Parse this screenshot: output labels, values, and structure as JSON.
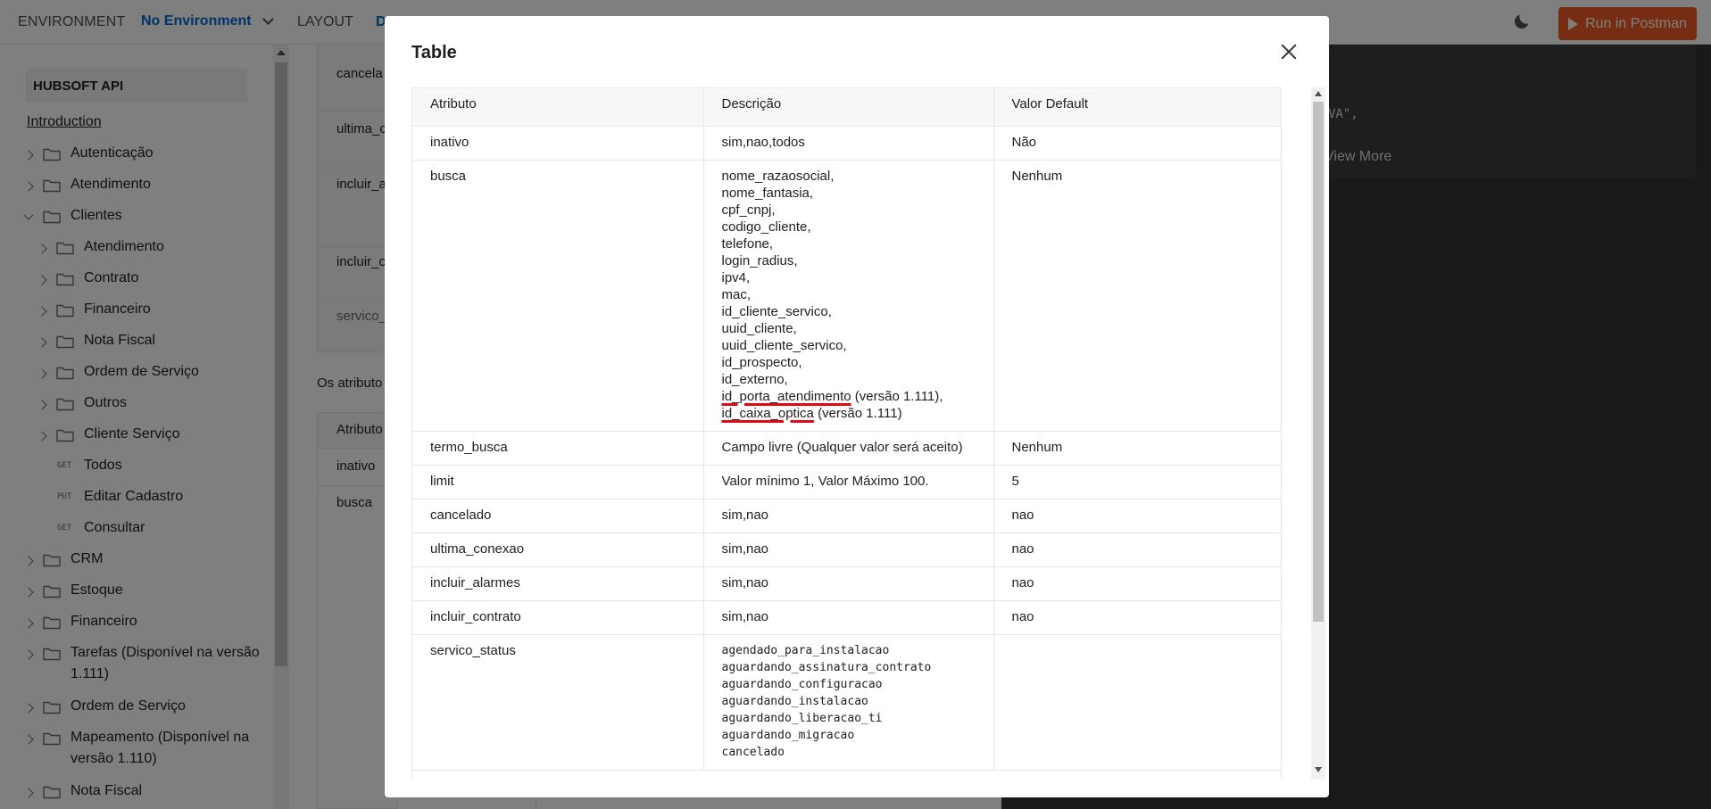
{
  "topbar": {
    "environment_label": "ENVIRONMENT",
    "environment_value": "No Environment",
    "layout_label": "LAYOUT",
    "partial_label": "D",
    "run_button": "Run in Postman"
  },
  "sidebar": {
    "title": "HUBSOFT API",
    "introduction": "Introduction",
    "items": [
      {
        "label": "Autenticação",
        "type": "folder"
      },
      {
        "label": "Atendimento",
        "type": "folder"
      },
      {
        "label": "Clientes",
        "type": "folder",
        "expanded": true
      },
      {
        "label": "Atendimento",
        "type": "folder",
        "level": 2
      },
      {
        "label": "Contrato",
        "type": "folder",
        "level": 2
      },
      {
        "label": "Financeiro",
        "type": "folder",
        "level": 2
      },
      {
        "label": "Nota Fiscal",
        "type": "folder",
        "level": 2
      },
      {
        "label": "Ordem de Serviço",
        "type": "folder",
        "level": 2
      },
      {
        "label": "Outros",
        "type": "folder",
        "level": 2
      },
      {
        "label": "Cliente Serviço",
        "type": "folder",
        "level": 2
      },
      {
        "label": "Todos",
        "method": "GET",
        "level": 2
      },
      {
        "label": "Editar Cadastro",
        "method": "PUT",
        "level": 2
      },
      {
        "label": "Consultar",
        "method": "GET",
        "level": 2
      },
      {
        "label": "CRM",
        "type": "folder"
      },
      {
        "label": "Estoque",
        "type": "folder"
      },
      {
        "label": "Financeiro",
        "type": "folder"
      },
      {
        "label": "Tarefas (Disponível na versão 1.111)",
        "type": "folder"
      },
      {
        "label": "Ordem de Serviço",
        "type": "folder"
      },
      {
        "label": "Mapeamento (Disponível na versão 1.110)",
        "type": "folder"
      },
      {
        "label": "Nota Fiscal",
        "type": "folder"
      }
    ]
  },
  "background_content": {
    "rows": [
      "cancela",
      "ultima_c",
      "incluir_a",
      "incluir_c",
      "servico_"
    ],
    "text": "Os atributo",
    "table_header": "Atributo",
    "table_rows": [
      "inativo",
      "busca"
    ],
    "code_snippet": "VA\",",
    "view_more": "View More"
  },
  "modal": {
    "title": "Table",
    "columns": [
      "Atributo",
      "Descrição",
      "Valor Default"
    ],
    "rows": [
      {
        "atributo": "inativo",
        "descricao": "sim,nao,todos",
        "default": "Não"
      },
      {
        "atributo": "busca",
        "descricao_lines": [
          "nome_razaosocial,",
          "nome_fantasia,",
          "cpf_cnpj,",
          "codigo_cliente,",
          "telefone,",
          "login_radius,",
          "ipv4,",
          "mac,",
          "id_cliente_servico,",
          "uuid_cliente,",
          "uuid_cliente_servico,",
          "id_prospecto,",
          "id_externo,"
        ],
        "descricao_underlined_1": "id_porta_atendimento",
        "descricao_suffix_1": " (versão 1.111),",
        "descricao_underlined_2": "id_caixa_optica",
        "descricao_suffix_2": " (versão 1.111)",
        "default": "Nenhum"
      },
      {
        "atributo": "termo_busca",
        "descricao": "Campo livre (Qualquer valor será aceito)",
        "default": "Nenhum"
      },
      {
        "atributo": "limit",
        "descricao": "Valor mínimo 1, Valor Máximo 100.",
        "default": "5"
      },
      {
        "atributo": "cancelado",
        "descricao": "sim,nao",
        "default": "nao"
      },
      {
        "atributo": "ultima_conexao",
        "descricao": "sim,nao",
        "default": "nao"
      },
      {
        "atributo": "incluir_alarmes",
        "descricao": "sim,nao",
        "default": "nao"
      },
      {
        "atributo": "incluir_contrato",
        "descricao": "sim,nao",
        "default": "nao"
      },
      {
        "atributo": "servico_status",
        "descricao_lines": [
          "agendado_para_instalacao",
          "aguardando_assinatura_contrato",
          "aguardando_configuracao",
          "aguardando_instalacao",
          "aguardando_liberacao_ti",
          "aguardando_migracao",
          "cancelado"
        ],
        "default": ""
      }
    ]
  },
  "colors": {
    "brand_orange": "#ef5b25",
    "link_blue": "#0265d2",
    "underline_red": "#e30613"
  }
}
